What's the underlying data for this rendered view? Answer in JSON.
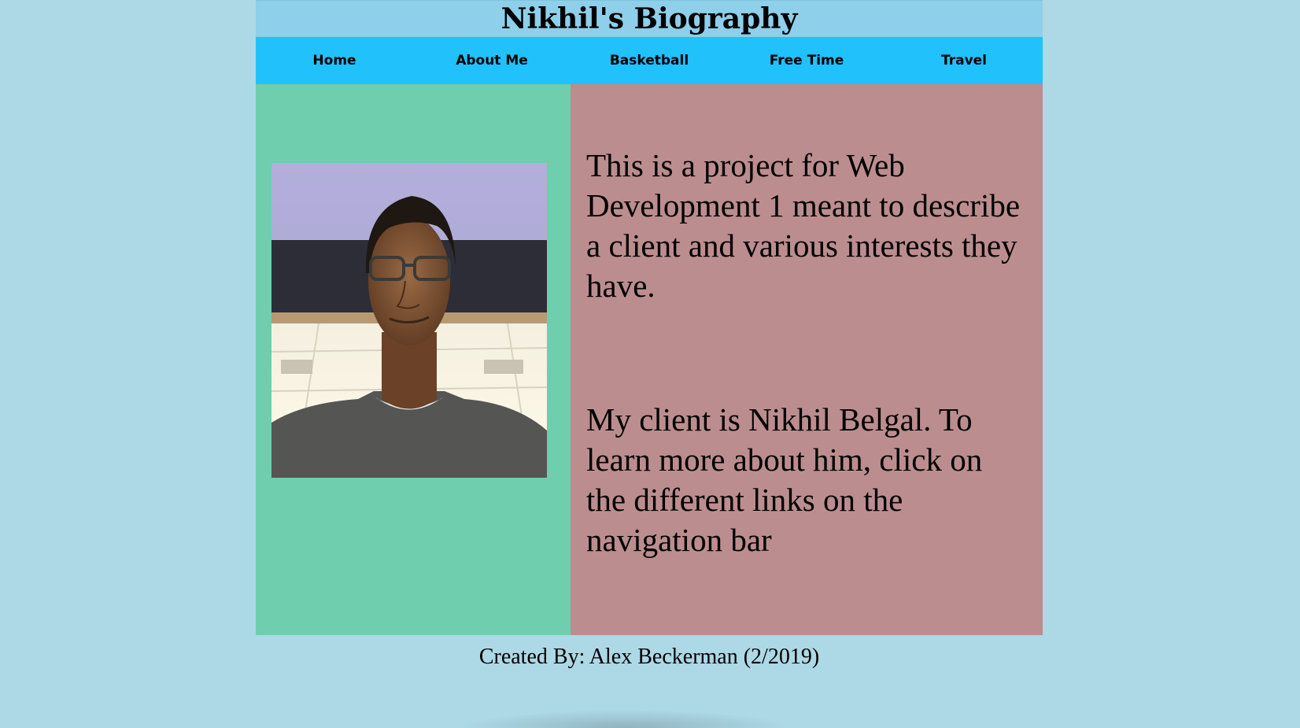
{
  "header": {
    "title": "Nikhil's Biography"
  },
  "nav": {
    "items": [
      {
        "label": "Home"
      },
      {
        "label": "About Me"
      },
      {
        "label": "Basketball"
      },
      {
        "label": "Free Time"
      },
      {
        "label": "Travel"
      }
    ]
  },
  "main": {
    "photo_alt": "Photo of Nikhil",
    "paragraph_1": "This is a project for Web Development 1 meant to describe a client and various interests they have.",
    "paragraph_2": "My client is Nikhil Belgal. To learn more about him, click on the different links on the navigation bar"
  },
  "footer": {
    "credit": "Created By: Alex Beckerman (2/2019)"
  },
  "colors": {
    "page_background": "#add8e6",
    "title_bar": "#8ecfea",
    "nav_bar": "#21c1fc",
    "left_column": "#6ecead",
    "right_column": "#bc8d8f"
  }
}
